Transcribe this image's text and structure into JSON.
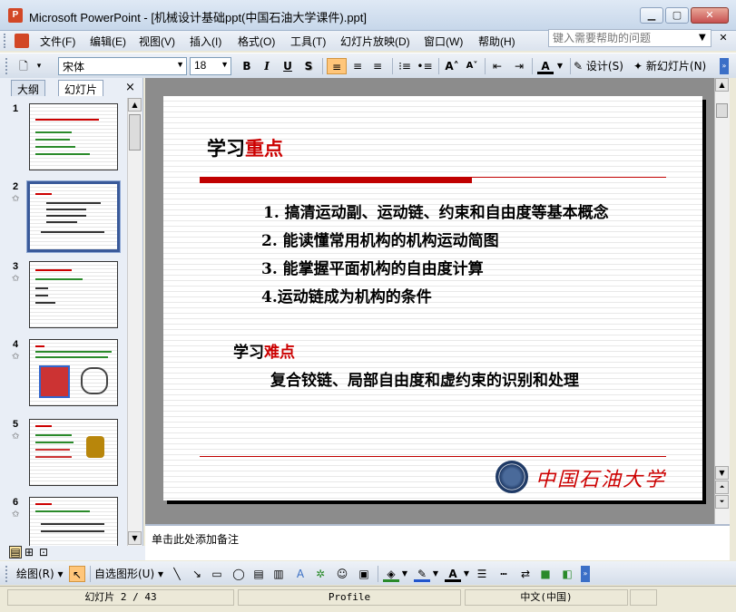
{
  "window": {
    "title": "Microsoft PowerPoint - [机械设计基础ppt(中国石油大学课件).ppt]",
    "app_icon": "powerpoint-icon"
  },
  "menu": {
    "items": [
      "文件(F)",
      "编辑(E)",
      "视图(V)",
      "插入(I)",
      "格式(O)",
      "工具(T)",
      "幻灯片放映(D)",
      "窗口(W)",
      "帮助(H)"
    ],
    "help_placeholder": "键入需要帮助的问题"
  },
  "toolbar": {
    "font": "宋体",
    "size": "18",
    "bold": "B",
    "italic": "I",
    "underline": "U",
    "shadow": "S",
    "design_label": "设计(S)",
    "new_slide_label": "新幻灯片(N)"
  },
  "left_pane": {
    "tabs": [
      "大纲",
      "幻灯片"
    ],
    "selected_tab": "幻灯片",
    "close_glyph": "×",
    "slide_numbers": [
      "1",
      "2",
      "3",
      "4",
      "5",
      "6"
    ],
    "selected_slide": "2"
  },
  "slide": {
    "title_prefix": "学习",
    "title_key": "重点",
    "points": [
      "1.  搞清运动副、运动链、约束和自由度等基本概念",
      "2.  能读懂常用机构的机构运动简图",
      "3.  能掌握平面机构的自由度计算",
      "4.运动链成为机构的条件"
    ],
    "sub_prefix": "学习",
    "sub_key": "难点",
    "sub_text": "复合铰链、局部自由度和虚约束的识别和处理",
    "logo_text": "中国石油大学"
  },
  "notes_placeholder": "单击此处添加备注",
  "drawbar": {
    "draw_label": "绘图(R)",
    "autoshape_label": "自选图形(U)"
  },
  "status": {
    "slide_counter": "幻灯片 2 / 43",
    "design": "Profile",
    "language": "中文(中国)"
  },
  "colors": {
    "accent_red": "#C00000",
    "logo_blue": "#1F3A66"
  }
}
